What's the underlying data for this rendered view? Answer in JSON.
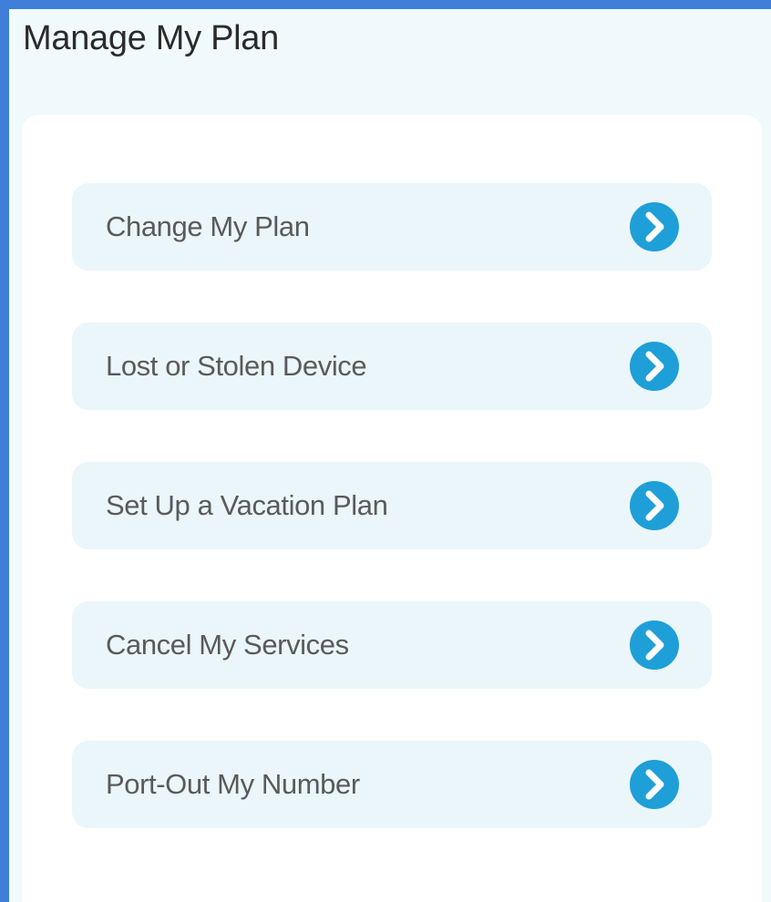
{
  "panel": {
    "title": "Manage My Plan"
  },
  "menu": {
    "items": [
      {
        "label": "Change My Plan",
        "icon": "chevron-right-circle-icon"
      },
      {
        "label": "Lost or Stolen Device",
        "icon": "chevron-right-circle-icon"
      },
      {
        "label": "Set Up a Vacation Plan",
        "icon": "chevron-right-circle-icon"
      },
      {
        "label": "Cancel My Services",
        "icon": "chevron-right-circle-icon"
      },
      {
        "label": "Port-Out My Number",
        "icon": "chevron-right-circle-icon"
      }
    ]
  },
  "colors": {
    "frame": "#3f7fd9",
    "panel_background": "#f0f9fc",
    "card_background": "#ffffff",
    "item_background": "#eaf6fa",
    "icon_accent": "#1e9fd8"
  }
}
